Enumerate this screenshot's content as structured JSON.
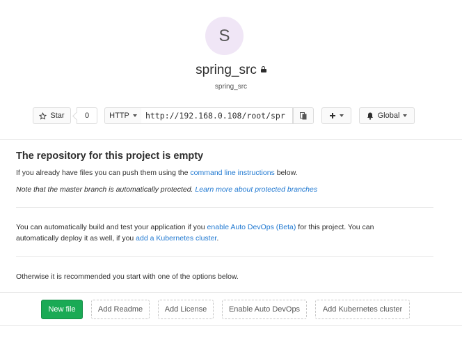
{
  "project": {
    "avatar_letter": "S",
    "name": "spring_src",
    "subtitle": "spring_src"
  },
  "toolbar": {
    "star_label": "Star",
    "star_count": "0",
    "protocol_label": "HTTP",
    "clone_url": "http://192.168.0.108/root/spr",
    "notification_label": "Global"
  },
  "empty_repo": {
    "heading": "The repository for this project is empty",
    "push_text_before": "If you already have files you can push them using the ",
    "push_link": "command line instructions",
    "push_text_after": " below.",
    "protected_note": "Note that the master branch is automatically protected. ",
    "protected_link": "Learn more about protected branches"
  },
  "devops": {
    "text_before": "You can automatically build and test your application if you ",
    "link_devops": "enable Auto DevOps (Beta)",
    "text_middle": " for this project. You can",
    "text_line2": "automatically deploy it as well, if you ",
    "link_k8s": "add a Kubernetes cluster",
    "text_end": "."
  },
  "options_text": "Otherwise it is recommended you start with one of the options below.",
  "actions": {
    "new_file": "New file",
    "add_readme": "Add Readme",
    "add_license": "Add License",
    "enable_devops": "Enable Auto DevOps",
    "add_k8s": "Add Kubernetes cluster"
  },
  "colors": {
    "link": "#1f78d1",
    "primary_green": "#1aaa55",
    "avatar_bg": "#f0e6f6"
  }
}
